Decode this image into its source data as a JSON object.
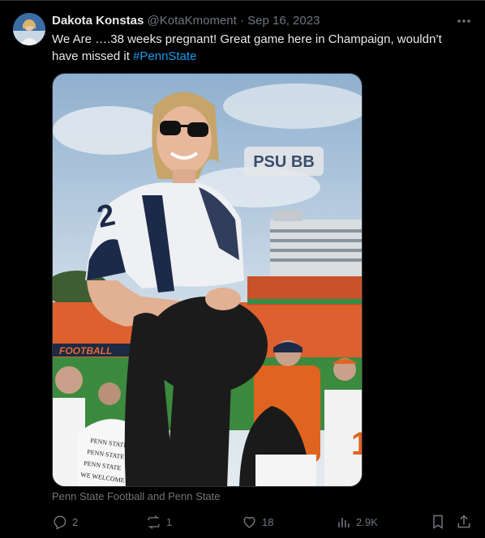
{
  "author": {
    "name": "Dakota Konstas",
    "handle": "@KotaKmoment",
    "separator": "·",
    "date": "Sep 16, 2023"
  },
  "tweet": {
    "text": "We Are ….38 weeks pregnant! Great game here in Champaign, wouldn’t have missed it ",
    "hashtag": "#PennState"
  },
  "media": {
    "sticker_text": "PSU BB",
    "banner_text": "FOOTBALL",
    "shirt_lines": [
      "PENN STATE",
      "PENN STATE",
      "PENN STATE",
      "WE WELCOME"
    ]
  },
  "caption": "Penn State Football and Penn State",
  "metrics": {
    "replies": "2",
    "reposts": "1",
    "likes": "18",
    "views": "2.9K"
  },
  "icons": {
    "more": "more-dots-icon",
    "reply": "reply-icon",
    "repost": "repost-icon",
    "like": "like-icon",
    "views": "views-icon",
    "bookmark": "bookmark-icon",
    "share": "share-icon"
  },
  "colors": {
    "background": "#000000",
    "text": "#e7e9ea",
    "muted": "#71767b",
    "link": "#1d9bf0"
  }
}
